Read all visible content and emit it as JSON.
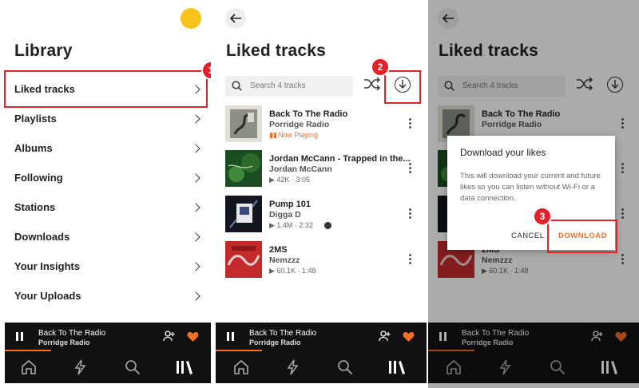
{
  "library": {
    "title": "Library",
    "items": [
      "Liked tracks",
      "Playlists",
      "Albums",
      "Following",
      "Stations",
      "Downloads",
      "Your Insights",
      "Your Uploads"
    ]
  },
  "liked": {
    "title": "Liked tracks",
    "search_placeholder": "Search 4 tracks",
    "tracks": [
      {
        "title": "Back To The Radio",
        "artist": "Porridge Radio",
        "meta": "Now Playing"
      },
      {
        "title": "Jordan McCann - Trapped in the...",
        "artist": "Jordan McCann",
        "meta": "▶ 42K · 3:05"
      },
      {
        "title": "Pump 101",
        "artist": "Digga D",
        "meta": "▶ 1.4M · 2:32"
      },
      {
        "title": "2MS",
        "artist": "Nemzzz",
        "meta": "▶ 60.1K · 1:48"
      }
    ]
  },
  "player": {
    "title": "Back To The Radio",
    "artist": "Porridge Radio"
  },
  "dialog": {
    "title": "Download your likes",
    "body": "This will download your current and future likes so you can listen without Wi-Fi or a data connection.",
    "cancel": "CANCEL",
    "download": "DOWNLOAD"
  },
  "badges": [
    "1",
    "2",
    "3"
  ],
  "colors": {
    "accent": "#f26f23",
    "annotation": "#e12228",
    "yellow": "#f9c31c"
  },
  "icons": [
    "back-arrow-icon",
    "search-icon",
    "shuffle-icon",
    "download-icon",
    "more-icon",
    "pause-icon",
    "add-user-icon",
    "heart-icon",
    "home-icon",
    "bolt-icon",
    "search-nav-icon",
    "library-icon"
  ]
}
